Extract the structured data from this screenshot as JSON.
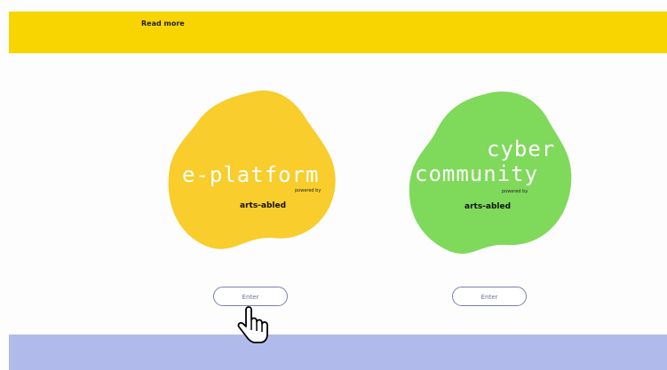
{
  "top_banner": {
    "color": "#f8d500",
    "read_more_label": "Read more"
  },
  "cards": [
    {
      "id": "e-platform",
      "title_lines": [
        "e-platform"
      ],
      "powered_by": "powered by",
      "brand_prefix": "arts-",
      "brand_suffix": "abled",
      "blob_color": "#f8cd2c",
      "enter_label": "Enter"
    },
    {
      "id": "cyber-community",
      "title_lines": [
        "cyber",
        "community"
      ],
      "powered_by": "powered by",
      "brand_prefix": "arts-",
      "brand_suffix": "abled",
      "blob_color": "#7fd95a",
      "enter_label": "Enter"
    }
  ],
  "bottom_band": {
    "color": "#b1bbeb"
  },
  "cursor": {
    "icon": "hand-pointer-icon"
  }
}
